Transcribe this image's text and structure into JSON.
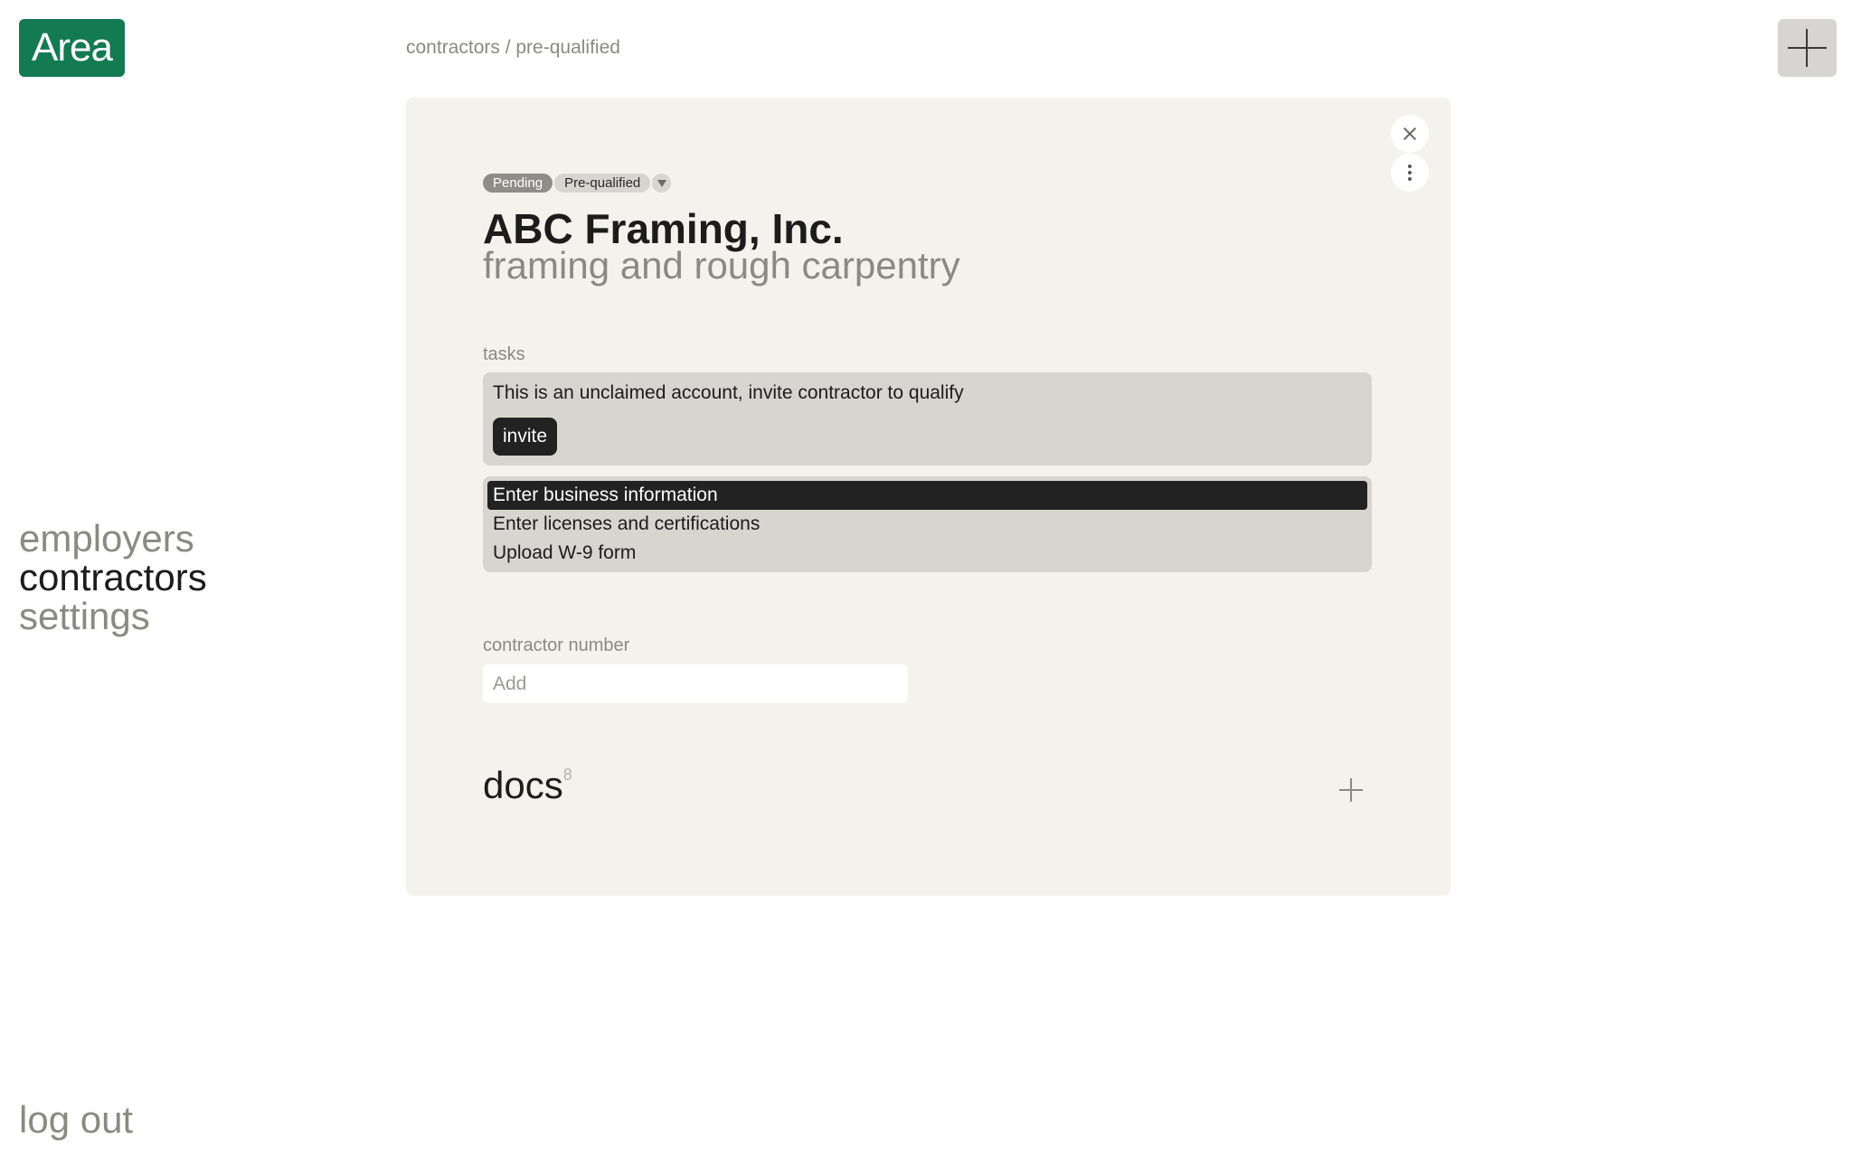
{
  "app": {
    "logo_text": "Area",
    "brand_color": "#137a52"
  },
  "header": {
    "breadcrumb": "contractors / pre-qualified"
  },
  "nav": {
    "items": [
      {
        "label": "employers",
        "active": false
      },
      {
        "label": "contractors",
        "active": true
      },
      {
        "label": "settings",
        "active": false
      }
    ],
    "logout_label": "log out"
  },
  "contractor": {
    "status_badge": "Pending",
    "qualification_badge": "Pre-qualified",
    "name": "ABC Framing, Inc.",
    "trade": "framing and rough carpentry"
  },
  "tasks": {
    "label": "tasks",
    "notice": "This is an unclaimed account, invite contractor to qualify",
    "invite_label": "invite",
    "steps": [
      {
        "label": "Enter business information",
        "current": true
      },
      {
        "label": "Enter licenses and certifications",
        "current": false
      },
      {
        "label": "Upload W-9 form",
        "current": false
      }
    ]
  },
  "contractor_number": {
    "label": "contractor number",
    "placeholder": "Add",
    "value": ""
  },
  "docs": {
    "title": "docs",
    "count": "8"
  },
  "icons": {
    "new": "plus-icon",
    "close": "close-icon",
    "more": "more-vertical-icon",
    "dropdown": "chevron-down-icon",
    "add_doc": "plus-icon"
  }
}
